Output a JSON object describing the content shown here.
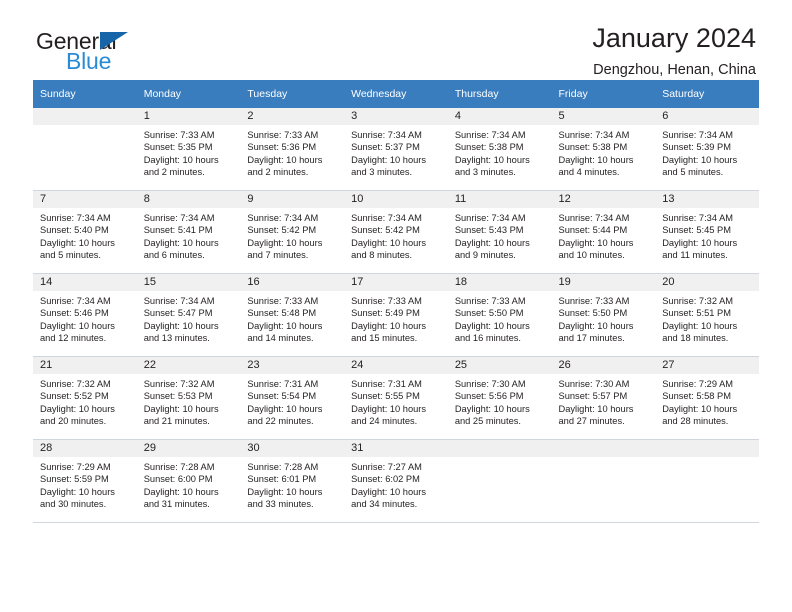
{
  "brand": {
    "name_part1": "General",
    "name_part2": "Blue",
    "triangle_color": "#1565a8",
    "blue_text_color": "#2a8bd5"
  },
  "header": {
    "title": "January 2024",
    "subtitle": "Dengzhou, Henan, China"
  },
  "theme": {
    "header_row_bg": "#3a7dbf",
    "day_number_bg": "#f0f0f0",
    "grid_line": "#cfd6dd",
    "text": "#231f20"
  },
  "weekday_headers": [
    "Sunday",
    "Monday",
    "Tuesday",
    "Wednesday",
    "Thursday",
    "Friday",
    "Saturday"
  ],
  "labels": {
    "sunrise_prefix": "Sunrise:",
    "sunset_prefix": "Sunset:",
    "daylight_prefix": "Daylight:"
  },
  "weeks": [
    [
      {
        "day": "",
        "sunrise": "",
        "sunset": "",
        "daylight_line1": "",
        "daylight_line2": ""
      },
      {
        "day": "1",
        "sunrise": "Sunrise: 7:33 AM",
        "sunset": "Sunset: 5:35 PM",
        "daylight_line1": "Daylight: 10 hours",
        "daylight_line2": "and 2 minutes."
      },
      {
        "day": "2",
        "sunrise": "Sunrise: 7:33 AM",
        "sunset": "Sunset: 5:36 PM",
        "daylight_line1": "Daylight: 10 hours",
        "daylight_line2": "and 2 minutes."
      },
      {
        "day": "3",
        "sunrise": "Sunrise: 7:34 AM",
        "sunset": "Sunset: 5:37 PM",
        "daylight_line1": "Daylight: 10 hours",
        "daylight_line2": "and 3 minutes."
      },
      {
        "day": "4",
        "sunrise": "Sunrise: 7:34 AM",
        "sunset": "Sunset: 5:38 PM",
        "daylight_line1": "Daylight: 10 hours",
        "daylight_line2": "and 3 minutes."
      },
      {
        "day": "5",
        "sunrise": "Sunrise: 7:34 AM",
        "sunset": "Sunset: 5:38 PM",
        "daylight_line1": "Daylight: 10 hours",
        "daylight_line2": "and 4 minutes."
      },
      {
        "day": "6",
        "sunrise": "Sunrise: 7:34 AM",
        "sunset": "Sunset: 5:39 PM",
        "daylight_line1": "Daylight: 10 hours",
        "daylight_line2": "and 5 minutes."
      }
    ],
    [
      {
        "day": "7",
        "sunrise": "Sunrise: 7:34 AM",
        "sunset": "Sunset: 5:40 PM",
        "daylight_line1": "Daylight: 10 hours",
        "daylight_line2": "and 5 minutes."
      },
      {
        "day": "8",
        "sunrise": "Sunrise: 7:34 AM",
        "sunset": "Sunset: 5:41 PM",
        "daylight_line1": "Daylight: 10 hours",
        "daylight_line2": "and 6 minutes."
      },
      {
        "day": "9",
        "sunrise": "Sunrise: 7:34 AM",
        "sunset": "Sunset: 5:42 PM",
        "daylight_line1": "Daylight: 10 hours",
        "daylight_line2": "and 7 minutes."
      },
      {
        "day": "10",
        "sunrise": "Sunrise: 7:34 AM",
        "sunset": "Sunset: 5:42 PM",
        "daylight_line1": "Daylight: 10 hours",
        "daylight_line2": "and 8 minutes."
      },
      {
        "day": "11",
        "sunrise": "Sunrise: 7:34 AM",
        "sunset": "Sunset: 5:43 PM",
        "daylight_line1": "Daylight: 10 hours",
        "daylight_line2": "and 9 minutes."
      },
      {
        "day": "12",
        "sunrise": "Sunrise: 7:34 AM",
        "sunset": "Sunset: 5:44 PM",
        "daylight_line1": "Daylight: 10 hours",
        "daylight_line2": "and 10 minutes."
      },
      {
        "day": "13",
        "sunrise": "Sunrise: 7:34 AM",
        "sunset": "Sunset: 5:45 PM",
        "daylight_line1": "Daylight: 10 hours",
        "daylight_line2": "and 11 minutes."
      }
    ],
    [
      {
        "day": "14",
        "sunrise": "Sunrise: 7:34 AM",
        "sunset": "Sunset: 5:46 PM",
        "daylight_line1": "Daylight: 10 hours",
        "daylight_line2": "and 12 minutes."
      },
      {
        "day": "15",
        "sunrise": "Sunrise: 7:34 AM",
        "sunset": "Sunset: 5:47 PM",
        "daylight_line1": "Daylight: 10 hours",
        "daylight_line2": "and 13 minutes."
      },
      {
        "day": "16",
        "sunrise": "Sunrise: 7:33 AM",
        "sunset": "Sunset: 5:48 PM",
        "daylight_line1": "Daylight: 10 hours",
        "daylight_line2": "and 14 minutes."
      },
      {
        "day": "17",
        "sunrise": "Sunrise: 7:33 AM",
        "sunset": "Sunset: 5:49 PM",
        "daylight_line1": "Daylight: 10 hours",
        "daylight_line2": "and 15 minutes."
      },
      {
        "day": "18",
        "sunrise": "Sunrise: 7:33 AM",
        "sunset": "Sunset: 5:50 PM",
        "daylight_line1": "Daylight: 10 hours",
        "daylight_line2": "and 16 minutes."
      },
      {
        "day": "19",
        "sunrise": "Sunrise: 7:33 AM",
        "sunset": "Sunset: 5:50 PM",
        "daylight_line1": "Daylight: 10 hours",
        "daylight_line2": "and 17 minutes."
      },
      {
        "day": "20",
        "sunrise": "Sunrise: 7:32 AM",
        "sunset": "Sunset: 5:51 PM",
        "daylight_line1": "Daylight: 10 hours",
        "daylight_line2": "and 18 minutes."
      }
    ],
    [
      {
        "day": "21",
        "sunrise": "Sunrise: 7:32 AM",
        "sunset": "Sunset: 5:52 PM",
        "daylight_line1": "Daylight: 10 hours",
        "daylight_line2": "and 20 minutes."
      },
      {
        "day": "22",
        "sunrise": "Sunrise: 7:32 AM",
        "sunset": "Sunset: 5:53 PM",
        "daylight_line1": "Daylight: 10 hours",
        "daylight_line2": "and 21 minutes."
      },
      {
        "day": "23",
        "sunrise": "Sunrise: 7:31 AM",
        "sunset": "Sunset: 5:54 PM",
        "daylight_line1": "Daylight: 10 hours",
        "daylight_line2": "and 22 minutes."
      },
      {
        "day": "24",
        "sunrise": "Sunrise: 7:31 AM",
        "sunset": "Sunset: 5:55 PM",
        "daylight_line1": "Daylight: 10 hours",
        "daylight_line2": "and 24 minutes."
      },
      {
        "day": "25",
        "sunrise": "Sunrise: 7:30 AM",
        "sunset": "Sunset: 5:56 PM",
        "daylight_line1": "Daylight: 10 hours",
        "daylight_line2": "and 25 minutes."
      },
      {
        "day": "26",
        "sunrise": "Sunrise: 7:30 AM",
        "sunset": "Sunset: 5:57 PM",
        "daylight_line1": "Daylight: 10 hours",
        "daylight_line2": "and 27 minutes."
      },
      {
        "day": "27",
        "sunrise": "Sunrise: 7:29 AM",
        "sunset": "Sunset: 5:58 PM",
        "daylight_line1": "Daylight: 10 hours",
        "daylight_line2": "and 28 minutes."
      }
    ],
    [
      {
        "day": "28",
        "sunrise": "Sunrise: 7:29 AM",
        "sunset": "Sunset: 5:59 PM",
        "daylight_line1": "Daylight: 10 hours",
        "daylight_line2": "and 30 minutes."
      },
      {
        "day": "29",
        "sunrise": "Sunrise: 7:28 AM",
        "sunset": "Sunset: 6:00 PM",
        "daylight_line1": "Daylight: 10 hours",
        "daylight_line2": "and 31 minutes."
      },
      {
        "day": "30",
        "sunrise": "Sunrise: 7:28 AM",
        "sunset": "Sunset: 6:01 PM",
        "daylight_line1": "Daylight: 10 hours",
        "daylight_line2": "and 33 minutes."
      },
      {
        "day": "31",
        "sunrise": "Sunrise: 7:27 AM",
        "sunset": "Sunset: 6:02 PM",
        "daylight_line1": "Daylight: 10 hours",
        "daylight_line2": "and 34 minutes."
      },
      {
        "day": "",
        "sunrise": "",
        "sunset": "",
        "daylight_line1": "",
        "daylight_line2": ""
      },
      {
        "day": "",
        "sunrise": "",
        "sunset": "",
        "daylight_line1": "",
        "daylight_line2": ""
      },
      {
        "day": "",
        "sunrise": "",
        "sunset": "",
        "daylight_line1": "",
        "daylight_line2": ""
      }
    ]
  ]
}
